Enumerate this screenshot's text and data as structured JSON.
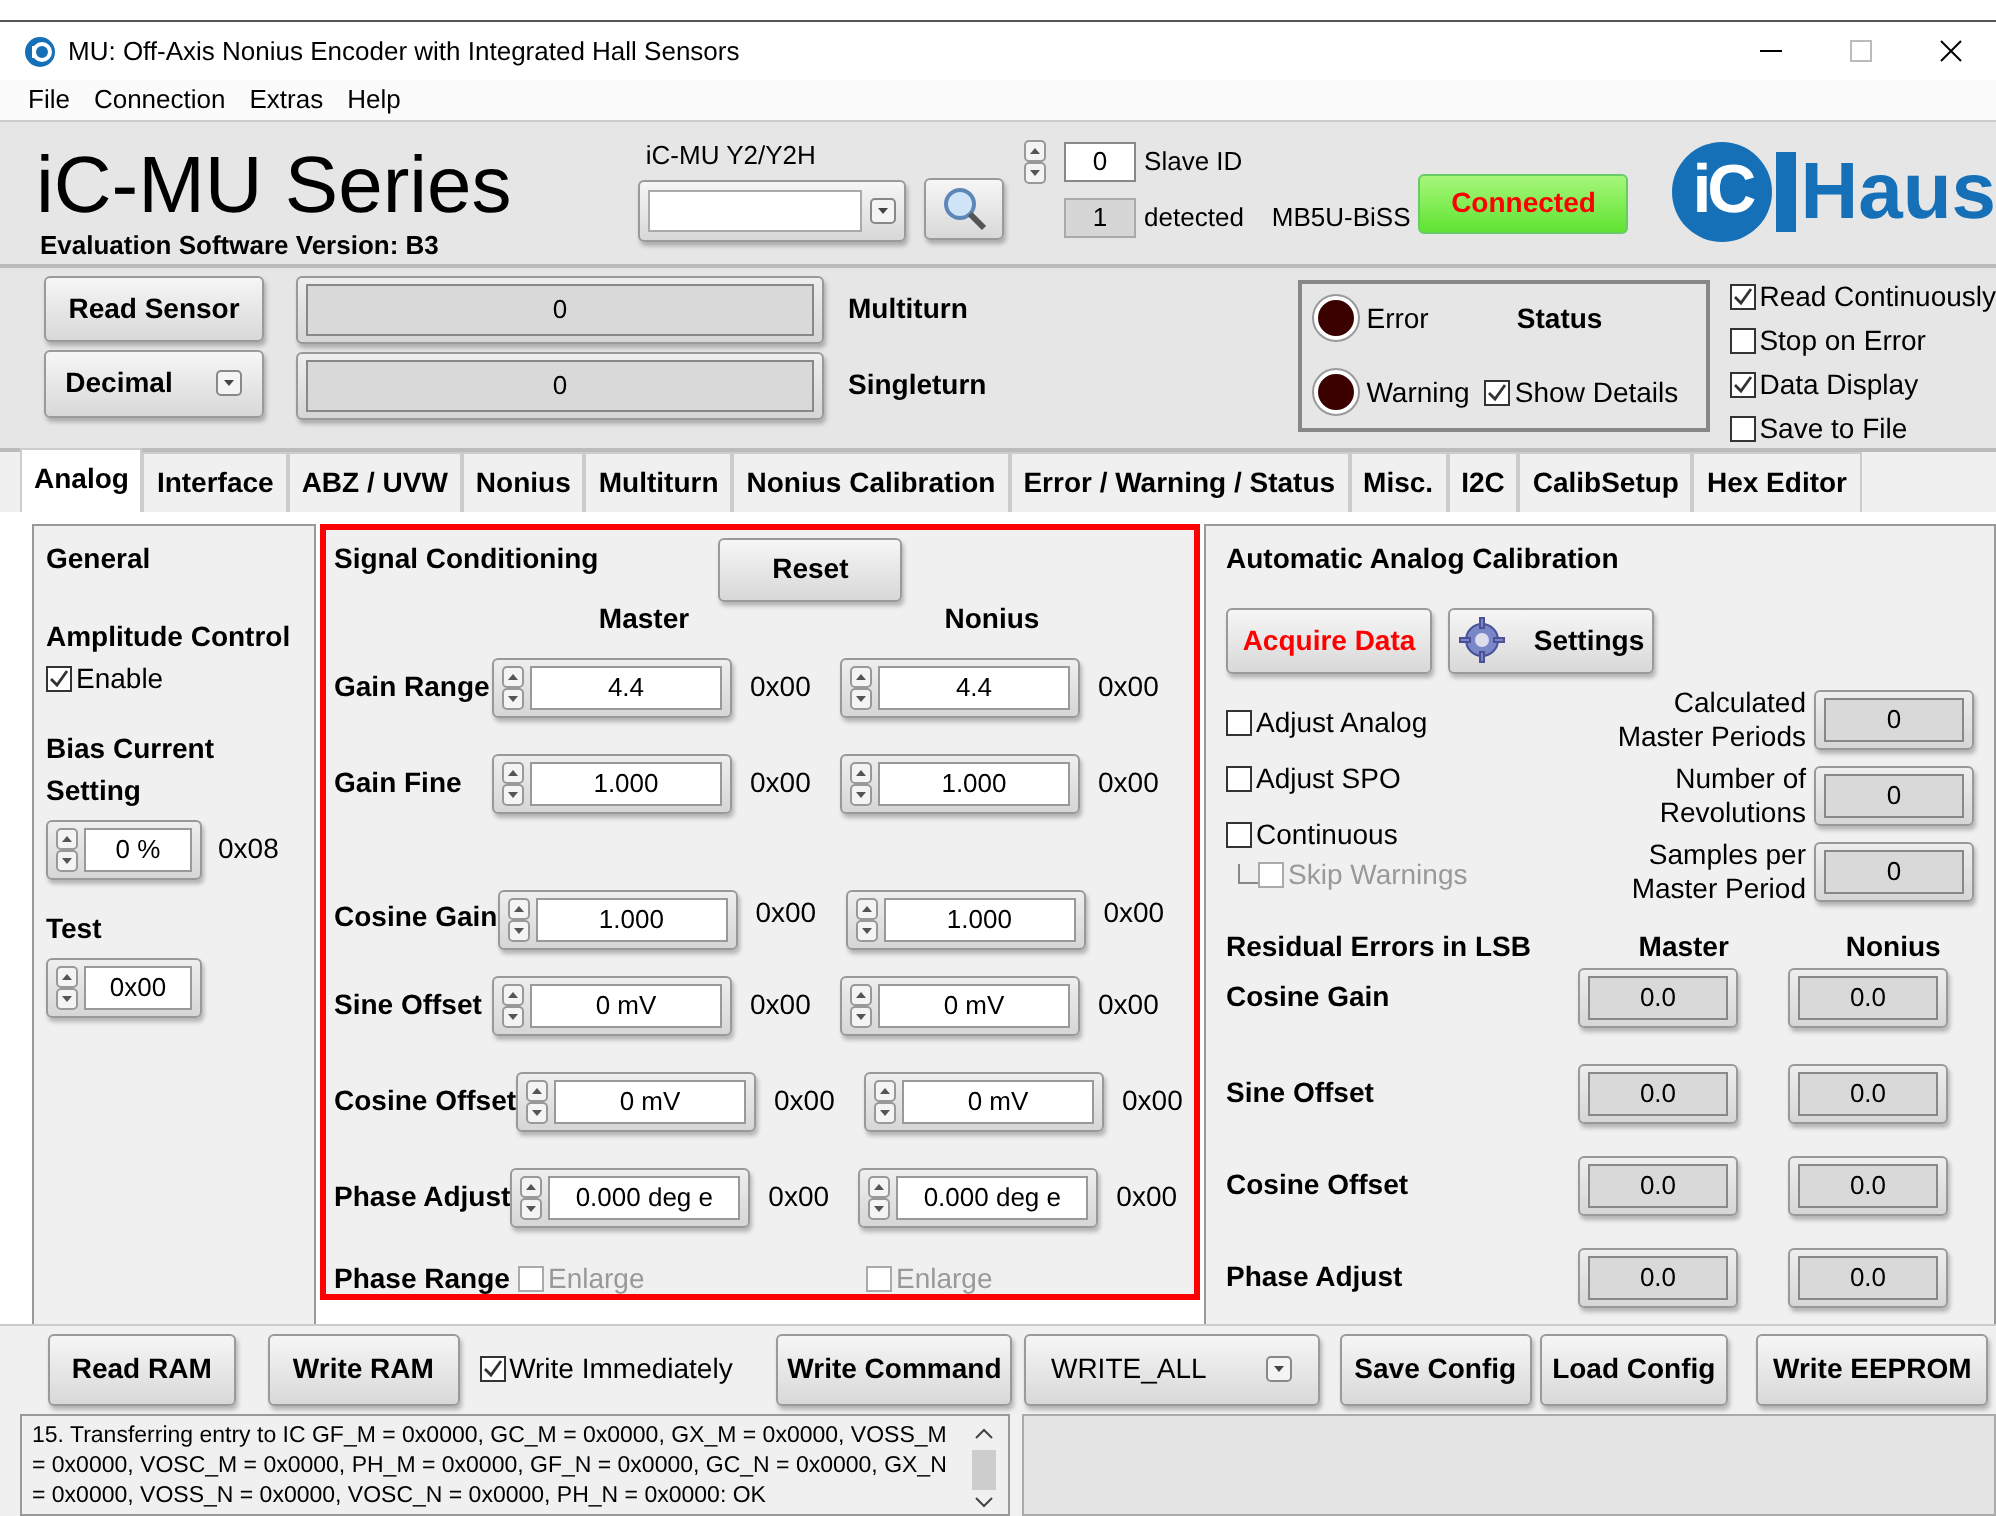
{
  "window": {
    "title": "MU: Off-Axis Nonius Encoder with Integrated Hall Sensors"
  },
  "menu": [
    "File",
    "Connection",
    "Extras",
    "Help"
  ],
  "header": {
    "product": "iC-MU Series",
    "version": "Evaluation Software Version: B3",
    "device_label": "iC-MU Y2/Y2H",
    "slave_id": "0",
    "slave_id_label": "Slave ID",
    "detected": "1",
    "detected_label": "detected",
    "adapter": "MB5U-BiSS",
    "connection": {
      "label": "Connected",
      "connected": true
    },
    "logo": {
      "mark": "iC",
      "word": "Haus"
    }
  },
  "sensor": {
    "read_button": "Read Sensor",
    "format": "Decimal",
    "readouts": [
      {
        "value": "0",
        "label": "Multiturn"
      },
      {
        "value": "0",
        "label": "Singleturn"
      }
    ]
  },
  "status": {
    "title": "Status",
    "leds": [
      {
        "label": "Error",
        "on": false
      },
      {
        "label": "Warning",
        "on": false
      }
    ],
    "show_details": {
      "label": "Show Details",
      "checked": true
    }
  },
  "options": [
    {
      "label": "Read Continuously",
      "checked": true
    },
    {
      "label": "Stop on Error",
      "checked": false
    },
    {
      "label": "Data Display",
      "checked": true
    },
    {
      "label": "Save to File",
      "checked": false
    }
  ],
  "tabs": [
    {
      "label": "Analog",
      "selected": true
    },
    {
      "label": "Interface",
      "selected": false
    },
    {
      "label": "ABZ / UVW",
      "selected": false
    },
    {
      "label": "Nonius",
      "selected": false
    },
    {
      "label": "Multiturn",
      "selected": false
    },
    {
      "label": "Nonius Calibration",
      "selected": false
    },
    {
      "label": "Error / Warning / Status",
      "selected": false
    },
    {
      "label": "Misc.",
      "selected": false
    },
    {
      "label": "I2C",
      "selected": false
    },
    {
      "label": "CalibSetup",
      "selected": false
    },
    {
      "label": "Hex Editor",
      "selected": false
    }
  ],
  "general": {
    "title": "General",
    "amplitude": {
      "label": "Amplitude Control",
      "enable": {
        "label": "Enable",
        "checked": true
      }
    },
    "bias": {
      "label": "Bias Current Setting",
      "value": "0 %",
      "hex": "0x08"
    },
    "test": {
      "label": "Test",
      "value": "0x00"
    }
  },
  "signal": {
    "title": "Signal Conditioning",
    "reset": "Reset",
    "columns": [
      "Master",
      "Nonius"
    ],
    "rows": [
      {
        "label": "Gain Range",
        "cells": [
          {
            "value": "4.4",
            "hex": "0x00"
          },
          {
            "value": "4.4",
            "hex": "0x00"
          }
        ]
      },
      {
        "label": "Gain Fine",
        "cells": [
          {
            "value": "1.000",
            "hex": "0x00"
          },
          {
            "value": "1.000",
            "hex": "0x00"
          }
        ]
      },
      {
        "label": "Cosine Gain",
        "cells": [
          {
            "value": "1.000",
            "hex": "0x00"
          },
          {
            "value": "1.000",
            "hex": "0x00"
          }
        ]
      },
      {
        "label": "Sine Offset",
        "cells": [
          {
            "value": "0 mV",
            "hex": "0x00"
          },
          {
            "value": "0 mV",
            "hex": "0x00"
          }
        ]
      },
      {
        "label": "Cosine Offset",
        "cells": [
          {
            "value": "0 mV",
            "hex": "0x00"
          },
          {
            "value": "0 mV",
            "hex": "0x00"
          }
        ]
      },
      {
        "label": "Phase Adjust",
        "cells": [
          {
            "value": "0.000 deg e",
            "hex": "0x00"
          },
          {
            "value": "0.000 deg e",
            "hex": "0x00"
          }
        ]
      }
    ],
    "phase_range": {
      "label": "Phase Range",
      "options": [
        {
          "label": "Enlarge",
          "checked": false,
          "disabled": true
        },
        {
          "label": "Enlarge",
          "checked": false,
          "disabled": true
        }
      ]
    }
  },
  "calibration": {
    "title": "Automatic Analog Calibration",
    "acquire": "Acquire Data",
    "settings": "Settings",
    "options": [
      {
        "label": "Adjust Analog",
        "checked": false,
        "disabled": false
      },
      {
        "label": "Adjust SPO",
        "checked": false,
        "disabled": false
      },
      {
        "label": "Continuous",
        "checked": false,
        "disabled": false,
        "children": [
          {
            "label": "Skip Warnings",
            "checked": false,
            "disabled": true
          }
        ]
      }
    ],
    "readouts": [
      {
        "label": "Calculated Master Periods",
        "value": "0"
      },
      {
        "label": "Number of Revolutions",
        "value": "0"
      },
      {
        "label": "Samples per Master Period",
        "value": "0"
      }
    ],
    "residual": {
      "title": "Residual Errors in LSB",
      "columns": [
        "Master",
        "Nonius"
      ],
      "rows": [
        {
          "label": "Cosine Gain",
          "values": [
            "0.0",
            "0.0"
          ]
        },
        {
          "label": "Sine Offset",
          "values": [
            "0.0",
            "0.0"
          ]
        },
        {
          "label": "Cosine Offset",
          "values": [
            "0.0",
            "0.0"
          ]
        },
        {
          "label": "Phase Adjust",
          "values": [
            "0.0",
            "0.0"
          ]
        }
      ]
    }
  },
  "bottom": [
    {
      "kind": "button",
      "label": "Read RAM"
    },
    {
      "kind": "button",
      "label": "Write RAM"
    },
    {
      "kind": "checkbox",
      "label": "Write Immediately",
      "checked": true
    },
    {
      "kind": "button",
      "label": "Write Command"
    },
    {
      "kind": "dropdown",
      "label": "WRITE_ALL"
    },
    {
      "kind": "button",
      "label": "Save Config"
    },
    {
      "kind": "button",
      "label": "Load Config"
    },
    {
      "kind": "button",
      "label": "Write EEPROM"
    }
  ],
  "log": "15. Transferring entry to IC GF_M = 0x0000, GC_M = 0x0000, GX_M = 0x0000, VOSS_M = 0x0000, VOSC_M = 0x0000, PH_M = 0x0000, GF_N = 0x0000, GC_N = 0x0000, GX_N = 0x0000, VOSS_N = 0x0000, VOSC_N = 0x0000, PH_N = 0x0000: OK"
}
